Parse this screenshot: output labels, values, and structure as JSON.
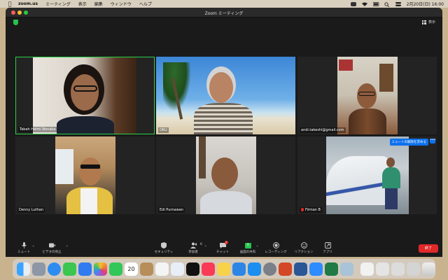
{
  "menubar": {
    "app_name": "zoom.us",
    "items": [
      "ミーティング",
      "表示",
      "編集",
      "ウィンドウ",
      "ヘルプ"
    ],
    "datetime": "2月20日(日)  16:00"
  },
  "window": {
    "title": "Zoom ミーティング",
    "view_label": "表示"
  },
  "participants": [
    {
      "name": "Tabah Helmi Nonaka",
      "active_speaker": true
    },
    {
      "name": "OKU"
    },
    {
      "name": "andi.takeshi@gmail.com"
    },
    {
      "name": "Denny Luthan"
    },
    {
      "name": "Edi Purnawan"
    },
    {
      "name": "Firman B",
      "muted": true
    }
  ],
  "unmute_request_label": "ミュートの解除を求める",
  "more_label": "•••",
  "toolbar": {
    "mute_label": "ミュート",
    "video_label": "ビデオの停止",
    "security_label": "セキュリティ",
    "participants_label": "参加者",
    "participants_count": "6",
    "chat_label": "チャット",
    "chat_badge": "1",
    "share_label": "画面の共有",
    "record_label": "レコーディング",
    "reactions_label": "リアクション",
    "apps_label": "アプリ",
    "end_label": "終了"
  },
  "dock": {
    "calendar_day": "20"
  },
  "colors": {
    "active_border": "#2bd14a",
    "end_button": "#e02828",
    "share_green": "#27c24c",
    "accent_blue": "#0e72ed"
  }
}
